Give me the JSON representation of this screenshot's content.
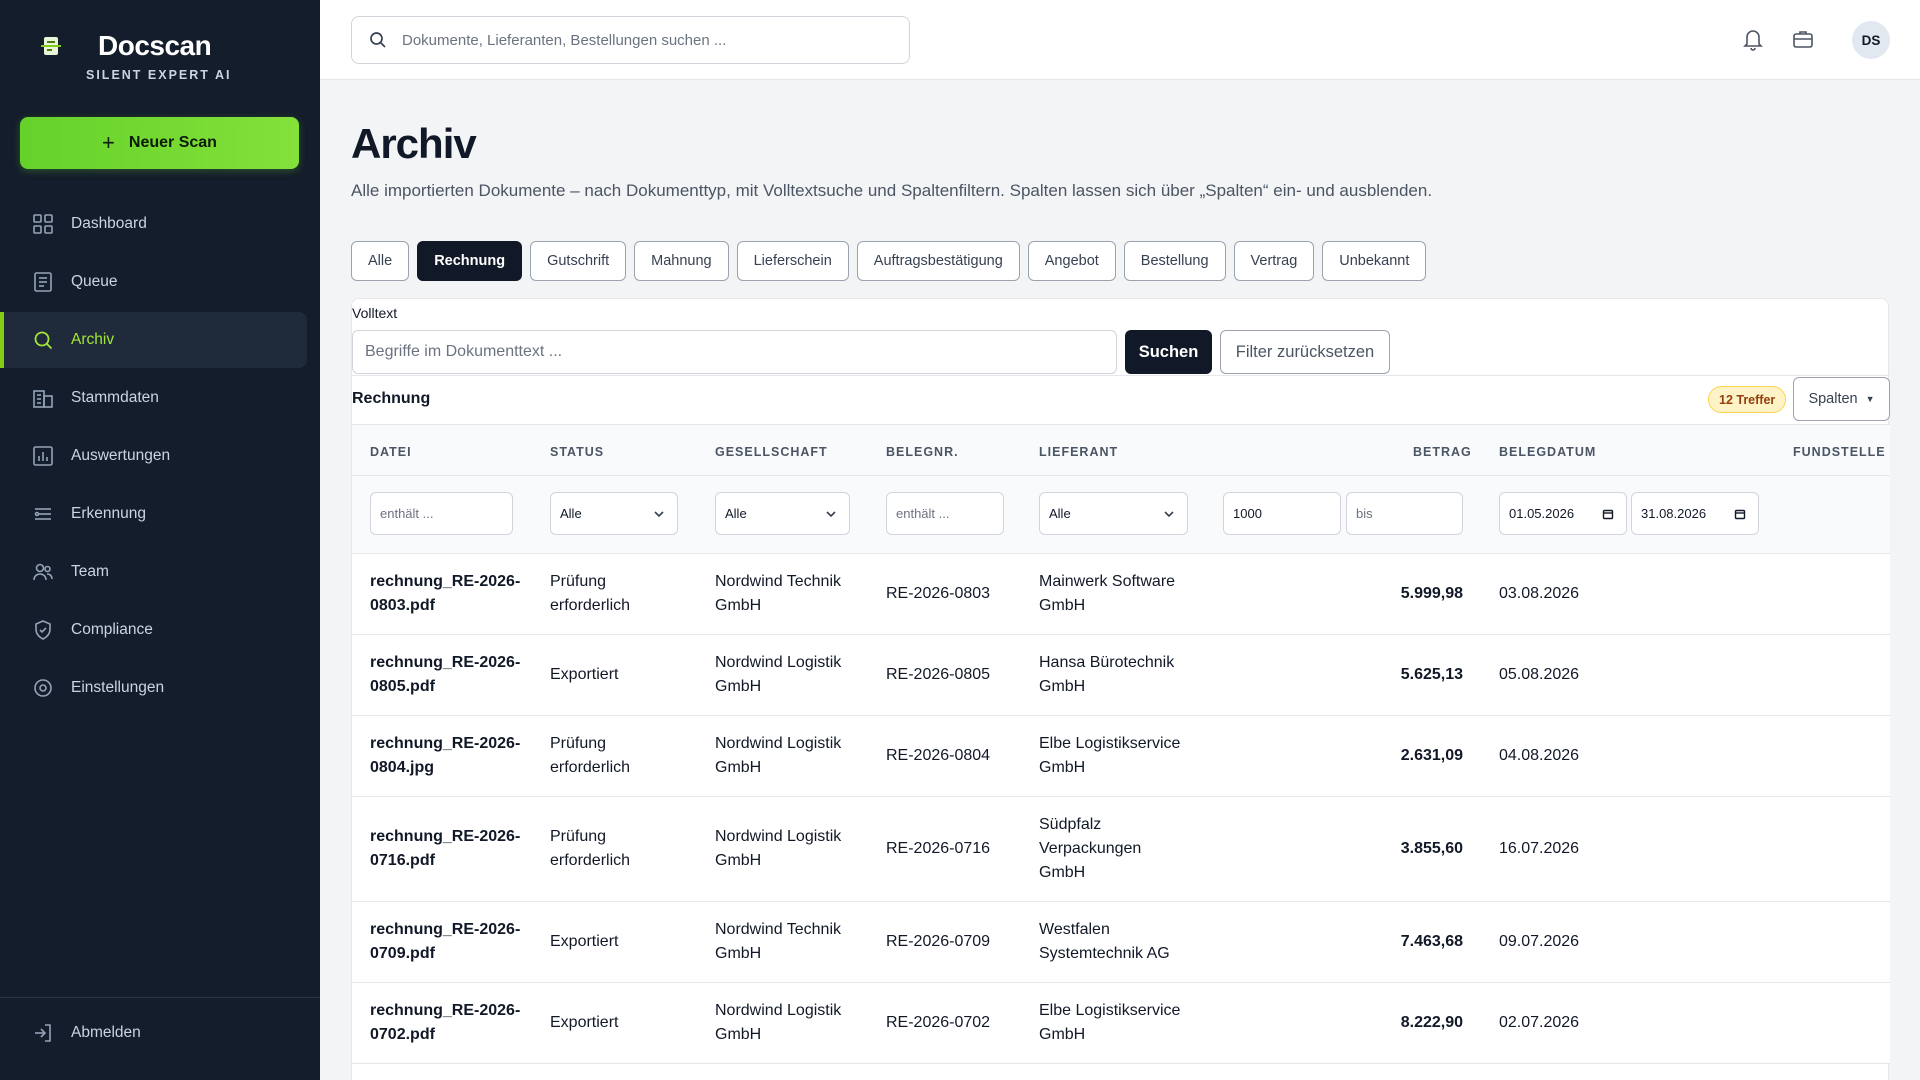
{
  "brand": {
    "name": "Docscan",
    "subtitle": "SILENT EXPERT AI"
  },
  "new_scan_label": "Neuer Scan",
  "nav": [
    {
      "label": "Dashboard",
      "icon": "grid-icon"
    },
    {
      "label": "Queue",
      "icon": "list-icon"
    },
    {
      "label": "Archiv",
      "icon": "search-icon",
      "active": true
    },
    {
      "label": "Stammdaten",
      "icon": "building-icon"
    },
    {
      "label": "Auswertungen",
      "icon": "bar-chart-icon"
    },
    {
      "label": "Erkennung",
      "icon": "filter-lines-icon"
    },
    {
      "label": "Team",
      "icon": "users-icon"
    },
    {
      "label": "Compliance",
      "icon": "shield-icon"
    },
    {
      "label": "Einstellungen",
      "icon": "gear-icon"
    }
  ],
  "logout_label": "Abmelden",
  "search": {
    "placeholder": "Dokumente, Lieferanten, Bestellungen suchen ..."
  },
  "avatar_initials": "DS",
  "page": {
    "title": "Archiv",
    "subtitle": "Alle importierten Dokumente – nach Dokumenttyp, mit Volltextsuche und Spaltenfiltern. Spalten lassen sich über „Spalten“ ein- und ausblenden."
  },
  "doc_types": [
    "Alle",
    "Rechnung",
    "Gutschrift",
    "Mahnung",
    "Lieferschein",
    "Auftragsbestätigung",
    "Angebot",
    "Bestellung",
    "Vertrag",
    "Unbekannt"
  ],
  "active_doc_type": "Rechnung",
  "fulltext": {
    "label": "Volltext",
    "placeholder": "Begriffe im Dokumenttext ...",
    "search_label": "Suchen",
    "reset_label": "Filter zurücksetzen"
  },
  "section": {
    "title": "Rechnung",
    "hits": "12 Treffer",
    "columns_label": "Spalten"
  },
  "columns": [
    "DATEI",
    "STATUS",
    "GESELLSCHAFT",
    "BELEGNR.",
    "LIEFERANT",
    "BETRAG",
    "BELEGDATUM",
    "FUNDSTELLE"
  ],
  "filters": {
    "datei_placeholder": "enthält ...",
    "status_value": "Alle",
    "gesellschaft_value": "Alle",
    "belegnr_placeholder": "enthält ...",
    "lieferant_value": "Alle",
    "betrag_from": "1000",
    "betrag_to_placeholder": "bis",
    "date_from": "01.05.2026",
    "date_to": "31.08.2026"
  },
  "rows": [
    {
      "file": [
        "rechnung_RE-2026-",
        "0803.pdf"
      ],
      "status": [
        "Prüfung",
        "erforderlich"
      ],
      "company": [
        "Nordwind Technik",
        "GmbH"
      ],
      "number": "RE-2026-0803",
      "supplier": [
        "Mainwerk Software",
        "GmbH"
      ],
      "amount": "5.999,98",
      "date": "03.08.2026"
    },
    {
      "file": [
        "rechnung_RE-2026-",
        "0805.pdf"
      ],
      "status": [
        "Exportiert"
      ],
      "company": [
        "Nordwind Logistik",
        "GmbH"
      ],
      "number": "RE-2026-0805",
      "supplier": [
        "Hansa Bürotechnik",
        "GmbH"
      ],
      "amount": "5.625,13",
      "date": "05.08.2026"
    },
    {
      "file": [
        "rechnung_RE-2026-",
        "0804.jpg"
      ],
      "status": [
        "Prüfung",
        "erforderlich"
      ],
      "company": [
        "Nordwind Logistik",
        "GmbH"
      ],
      "number": "RE-2026-0804",
      "supplier": [
        "Elbe Logistikservice",
        "GmbH"
      ],
      "amount": "2.631,09",
      "date": "04.08.2026"
    },
    {
      "file": [
        "rechnung_RE-2026-",
        "0716.pdf"
      ],
      "status": [
        "Prüfung",
        "erforderlich"
      ],
      "company": [
        "Nordwind Logistik",
        "GmbH"
      ],
      "number": "RE-2026-0716",
      "supplier": [
        "Südpfalz",
        "Verpackungen",
        "GmbH"
      ],
      "amount": "3.855,60",
      "date": "16.07.2026"
    },
    {
      "file": [
        "rechnung_RE-2026-",
        "0709.pdf"
      ],
      "status": [
        "Exportiert"
      ],
      "company": [
        "Nordwind Technik",
        "GmbH"
      ],
      "number": "RE-2026-0709",
      "supplier": [
        "Westfalen",
        "Systemtechnik AG"
      ],
      "amount": "7.463,68",
      "date": "09.07.2026"
    },
    {
      "file": [
        "rechnung_RE-2026-",
        "0702.pdf"
      ],
      "status": [
        "Exportiert"
      ],
      "company": [
        "Nordwind Logistik",
        "GmbH"
      ],
      "number": "RE-2026-0702",
      "supplier": [
        "Elbe Logistikservice",
        "GmbH"
      ],
      "amount": "8.222,90",
      "date": "02.07.2026"
    }
  ],
  "colors": {
    "sidebar_bg": "#141d2b",
    "accent": "#84cc16",
    "dark_button": "#111827",
    "badge_bg": "#fef3c7"
  }
}
